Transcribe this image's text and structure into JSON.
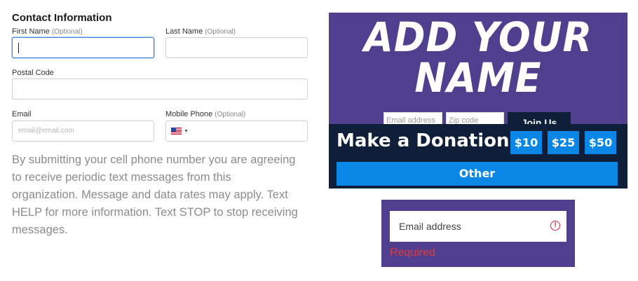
{
  "contact_form": {
    "title": "Contact Information",
    "first_name": {
      "label": "First Name",
      "optional": "(Optional)",
      "value": ""
    },
    "last_name": {
      "label": "Last Name",
      "optional": "(Optional)",
      "value": ""
    },
    "postal_code": {
      "label": "Postal Code",
      "value": ""
    },
    "email": {
      "label": "Email",
      "placeholder": "email@email.com",
      "value": ""
    },
    "mobile_phone": {
      "label": "Mobile Phone",
      "optional": "(Optional)",
      "country_icon": "us-flag-icon",
      "value": ""
    },
    "disclaimer": "By submitting your cell phone number you are agreeing to receive periodic text messages from this organization. Message and data rates may apply. Text HELP for more information. Text STOP to stop receiving messages."
  },
  "banner": {
    "headline_line1": "ADD YOUR",
    "headline_line2": "NAME",
    "signup": {
      "email_placeholder": "Email address",
      "zip_placeholder": "Zip code",
      "join_label": "Join Us"
    },
    "donation": {
      "title": "Make a Donation",
      "amounts": [
        "$10",
        "$25",
        "$50"
      ],
      "other_label": "Other"
    },
    "colors": {
      "background": "#4f3f8e",
      "navy": "#0f1f3a",
      "button_blue": "#0a87e6"
    }
  },
  "error_state": {
    "input_text": "Email address",
    "icon": "alert-circle-icon",
    "error_message": "Required",
    "error_color": "#e23a3a"
  }
}
